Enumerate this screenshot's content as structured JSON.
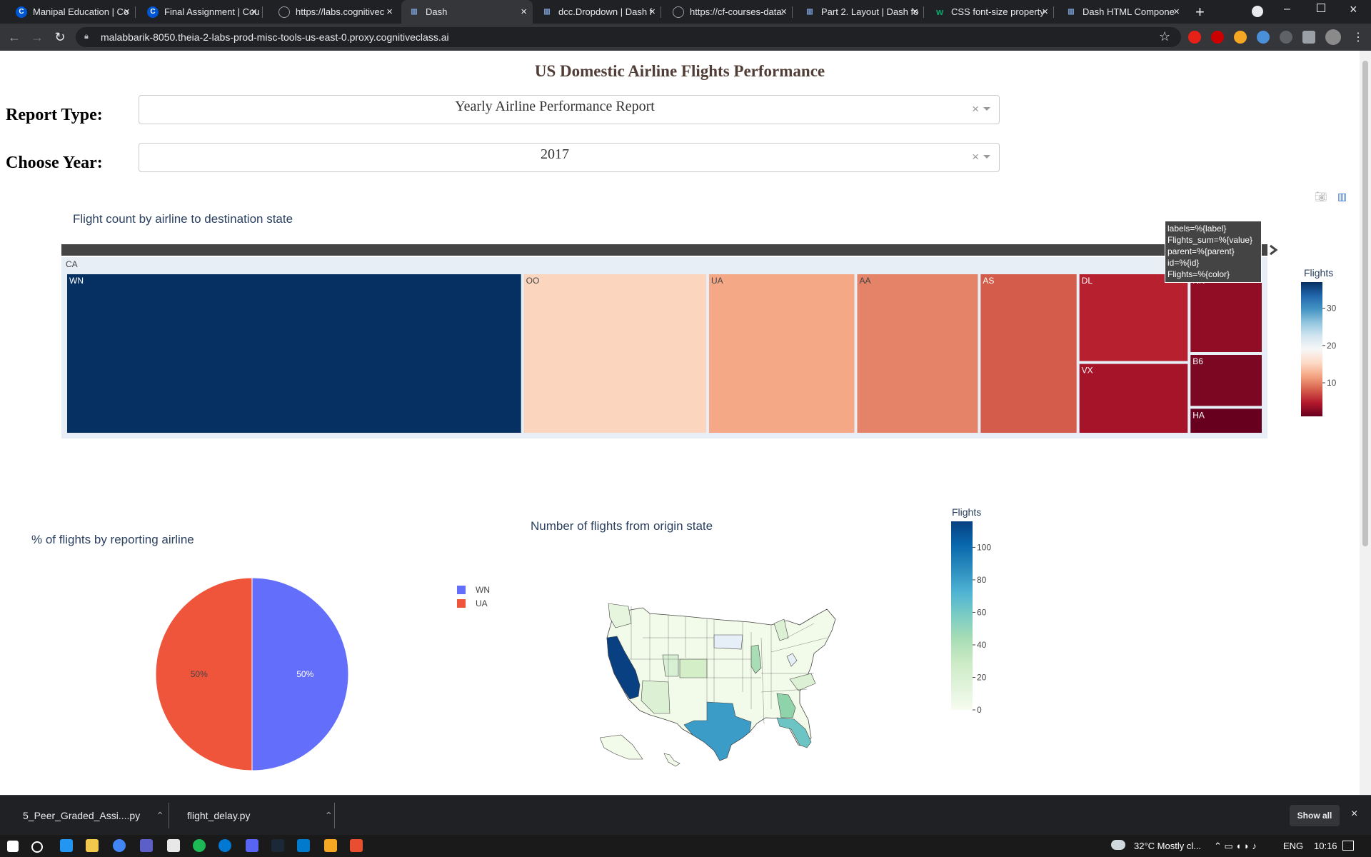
{
  "browser": {
    "tabs": [
      {
        "title": "Manipal Education | Co",
        "icon": "coursera-c-icon",
        "color": "#0056d2"
      },
      {
        "title": "Final Assignment | Cou",
        "icon": "coursera-c-icon",
        "color": "#0056d2"
      },
      {
        "title": "https://labs.cognitivec",
        "icon": "globe-icon",
        "color": "#9aa0a6"
      },
      {
        "title": "Dash",
        "icon": "dash-icon",
        "color": "#7b9fd4",
        "active": true
      },
      {
        "title": "dcc.Dropdown | Dash f",
        "icon": "dash-icon",
        "color": "#7b9fd4"
      },
      {
        "title": "https://cf-courses-data.",
        "icon": "globe-icon",
        "color": "#9aa0a6"
      },
      {
        "title": "Part 2. Layout | Dash fo",
        "icon": "dash-icon",
        "color": "#7b9fd4"
      },
      {
        "title": "CSS font-size property",
        "icon": "w3schools-icon",
        "color": "#04aa6d"
      },
      {
        "title": "Dash HTML Compone",
        "icon": "dash-icon",
        "color": "#7b9fd4"
      }
    ],
    "url": "malabbarik-8050.theia-2-labs-prod-misc-tools-us-east-0.proxy.cognitiveclass.ai"
  },
  "page": {
    "title": "US Domestic Airline Flights Performance",
    "report_type_label": "Report Type:",
    "report_type_value": "Yearly Airline Performance Report",
    "year_label": "Choose Year:",
    "year_value": "2017"
  },
  "tooltip": {
    "lines": [
      "labels=%{label}",
      "Flights_sum=%{value}",
      "parent=%{parent}",
      "id=%{id}",
      "Flights=%{color}"
    ]
  },
  "chart_data": [
    {
      "type": "treemap",
      "title": "Flight count by airline to destination state",
      "root": "CA",
      "colorbar_title": "Flights",
      "colorbar_ticks": [
        10,
        20,
        30
      ],
      "colorscale": [
        "#67001f",
        "#b2182b",
        "#d6604d",
        "#f4a582",
        "#fddbc7",
        "#f7f7f7",
        "#d1e5f0",
        "#92c5de",
        "#4393c3",
        "#2166ac",
        "#053061"
      ],
      "items": [
        {
          "label": "WN",
          "value": 37
        },
        {
          "label": "OO",
          "value": 15
        },
        {
          "label": "UA",
          "value": 12
        },
        {
          "label": "AA",
          "value": 10
        },
        {
          "label": "AS",
          "value": 8
        },
        {
          "label": "DL",
          "value": 5
        },
        {
          "label": "VX",
          "value": 4
        },
        {
          "label": "NK",
          "value": 3
        },
        {
          "label": "B6",
          "value": 2
        },
        {
          "label": "HA",
          "value": 1
        }
      ]
    },
    {
      "type": "pie",
      "title": "% of flights by reporting airline",
      "slices": [
        {
          "label": "WN",
          "value": 50,
          "color": "#636efa"
        },
        {
          "label": "UA",
          "value": 50,
          "color": "#ef553b"
        }
      ],
      "legend": [
        "WN",
        "UA"
      ]
    },
    {
      "type": "choropleth",
      "title": "Number of flights from origin state",
      "colorbar_title": "Flights",
      "colorbar_ticks": [
        0,
        20,
        40,
        60,
        80,
        100
      ],
      "colorscale": [
        "#f7fcf0",
        "#e0f3db",
        "#ccebc5",
        "#a8ddb5",
        "#7bccc4",
        "#4eb3d3",
        "#2b8cbe",
        "#0868ac",
        "#084081"
      ]
    }
  ],
  "downloads": [
    {
      "name": "5_Peer_Graded_Assi....py"
    },
    {
      "name": "flight_delay.py"
    }
  ],
  "downloads_show_all": "Show all",
  "taskbar": {
    "weather": "32°C  Mostly cl...",
    "lang": "ENG",
    "time": "10:16"
  }
}
